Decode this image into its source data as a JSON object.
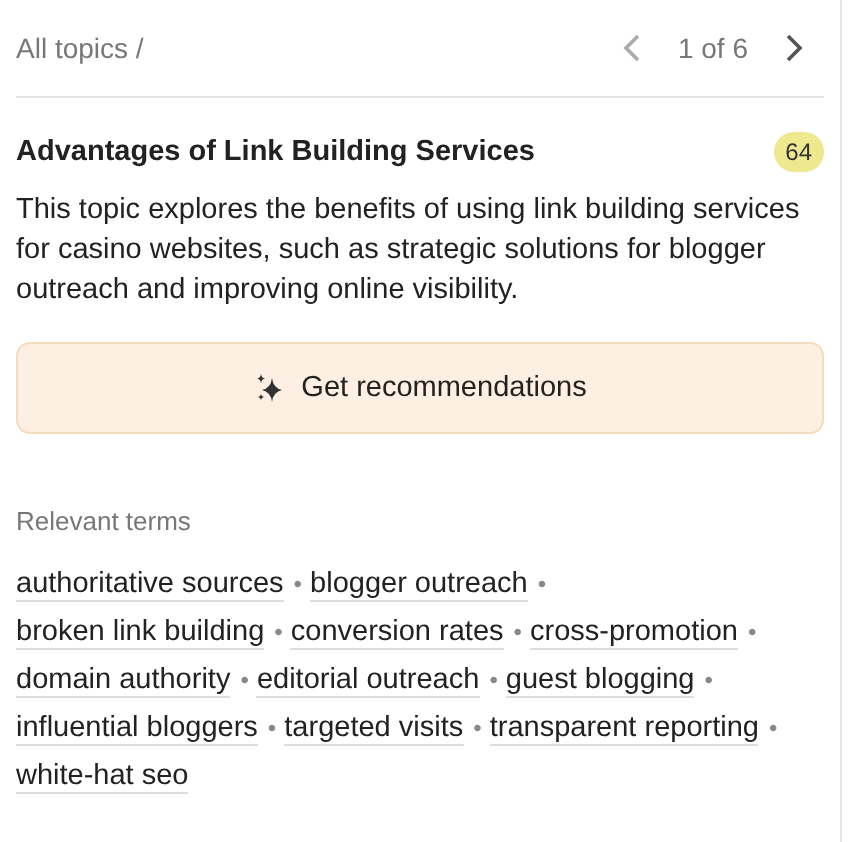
{
  "breadcrumb": "All topics /",
  "pager": {
    "text": "1 of 6",
    "prev_disabled": true,
    "next_disabled": false
  },
  "topic": {
    "title": "Advantages of Link Building Services",
    "score": "64",
    "description": "This topic explores the benefits of using link building services for casino websites, such as strategic solutions for blogger outreach and improving online visibility."
  },
  "button": {
    "label": "Get recommendations"
  },
  "terms_heading": "Relevant terms",
  "terms": [
    {
      "text": "authoritative sources",
      "separator": "•"
    },
    {
      "text": "blogger outreach",
      "separator": "•"
    },
    {
      "text": "broken link building",
      "separator": "•"
    },
    {
      "text": "conversion rates",
      "separator": "•"
    },
    {
      "text": "cross-promotion",
      "separator": "•"
    },
    {
      "text": "domain authority",
      "separator": "•"
    },
    {
      "text": "editorial outreach",
      "separator": "•"
    },
    {
      "text": "guest blogging",
      "separator": "•"
    },
    {
      "text": "influential bloggers",
      "separator": "•"
    },
    {
      "text": "targeted visits",
      "separator": "•"
    },
    {
      "text": "transparent reporting",
      "separator": "•"
    },
    {
      "text": "white-hat seo"
    }
  ]
}
